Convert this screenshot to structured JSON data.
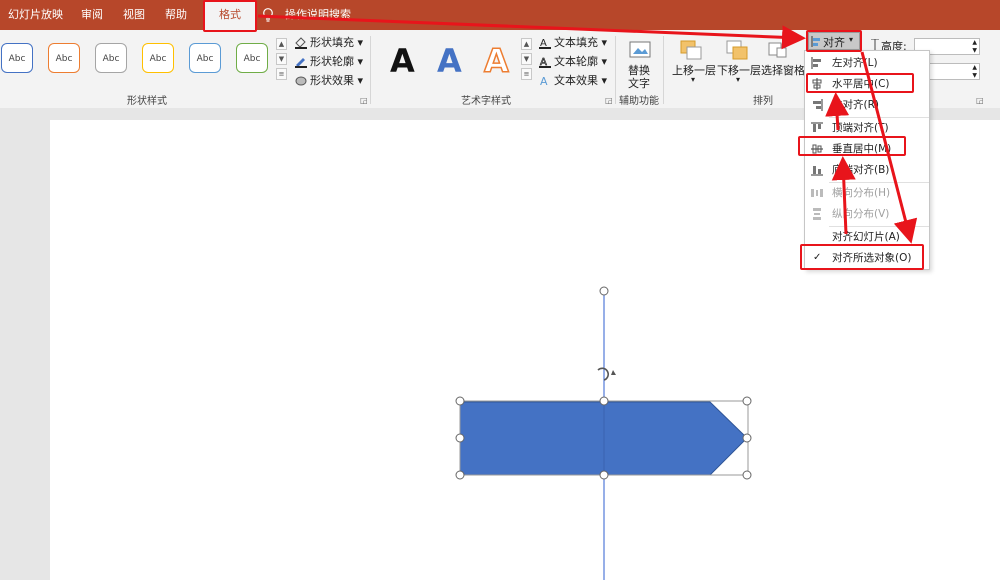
{
  "tabs": {
    "slideshow": "幻灯片放映",
    "review": "审阅",
    "view": "视图",
    "help": "帮助",
    "format": "格式",
    "tell_me": "操作说明搜索"
  },
  "shape_styles": {
    "sample_text": "Abc",
    "fill": "形状填充",
    "outline": "形状轮廓",
    "effects": "形状效果",
    "group_label": "形状样式",
    "border_colors": [
      "#4472c4",
      "#ed7d31",
      "#a5a5a5",
      "#ffc000",
      "#5b9bd5",
      "#70ad47"
    ]
  },
  "wordart": {
    "letter": "A",
    "text_fill": "文本填充",
    "text_outline": "文本轮廓",
    "text_effects": "文本效果",
    "group_label": "艺术字样式"
  },
  "accessibility": {
    "alt_text_line1": "替换",
    "alt_text_line2": "文字",
    "group_label": "辅助功能"
  },
  "arrange": {
    "bring_forward": "上移一层",
    "send_backward": "下移一层",
    "selection_pane": "选择窗格",
    "align": "对齐",
    "group_label": "排列"
  },
  "size": {
    "height_label": "高度:"
  },
  "align_menu": {
    "items": [
      {
        "label": "左对齐(L)",
        "enabled": true
      },
      {
        "label": "水平居中(C)",
        "enabled": true
      },
      {
        "label": "右对齐(R)",
        "enabled": true
      },
      {
        "label": "顶端对齐(T)",
        "enabled": true
      },
      {
        "label": "垂直居中(M)",
        "enabled": true
      },
      {
        "label": "底端对齐(B)",
        "enabled": true
      },
      {
        "label": "横向分布(H)",
        "enabled": false
      },
      {
        "label": "纵向分布(V)",
        "enabled": false
      },
      {
        "label": "对齐幻灯片(A)",
        "enabled": true
      },
      {
        "label": "对齐所选对象(O)",
        "enabled": true,
        "checked": true
      }
    ],
    "check_mark": "✓"
  },
  "colors": {
    "accent": "#b7472a",
    "annotation": "#e8141b",
    "shape_fill": "#4472c4",
    "guide_line": "#2f5fd1"
  }
}
